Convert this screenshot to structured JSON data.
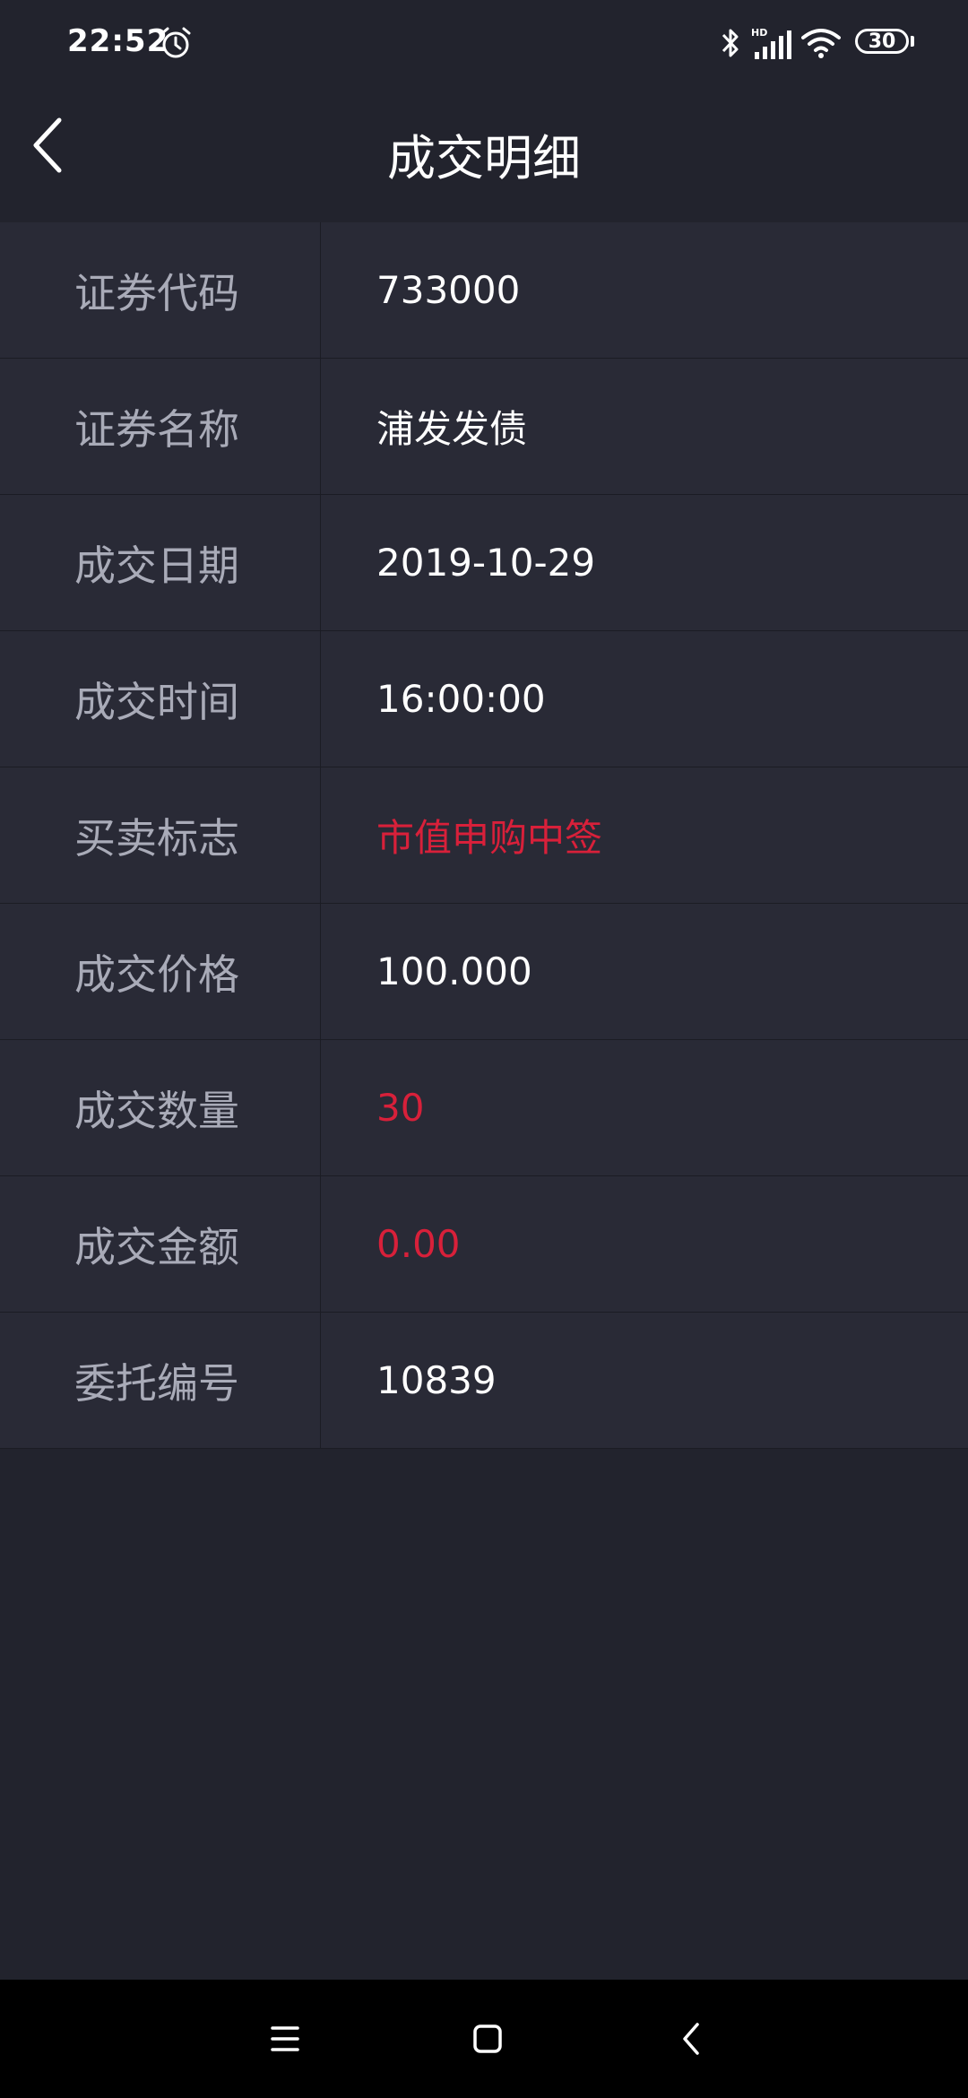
{
  "status_bar": {
    "time": "22:52",
    "battery": "30",
    "icons": [
      "alarm-icon",
      "bluetooth-icon",
      "hd-signal-icon",
      "wifi-icon",
      "battery-icon"
    ]
  },
  "header": {
    "title": "成交明细",
    "back_icon": "chevron-left-icon"
  },
  "details": [
    {
      "label": "证券代码",
      "value": "733000",
      "highlight": false
    },
    {
      "label": "证券名称",
      "value": "浦发发债",
      "highlight": false
    },
    {
      "label": "成交日期",
      "value": "2019-10-29",
      "highlight": false
    },
    {
      "label": "成交时间",
      "value": "16:00:00",
      "highlight": false
    },
    {
      "label": "买卖标志",
      "value": "市值申购中签",
      "highlight": true
    },
    {
      "label": "成交价格",
      "value": "100.000",
      "highlight": false
    },
    {
      "label": "成交数量",
      "value": "30",
      "highlight": true
    },
    {
      "label": "成交金额",
      "value": "0.00",
      "highlight": true
    },
    {
      "label": "委托编号",
      "value": "10839",
      "highlight": false
    }
  ],
  "nav_bar": {
    "icons": [
      "menu-icon",
      "home-square-icon",
      "back-chevron-icon"
    ]
  },
  "colors": {
    "background": "#22232d",
    "row_background": "#292a36",
    "label_text": "#a9abb8",
    "value_text": "#ffffff",
    "highlight_red": "#d8203a"
  }
}
